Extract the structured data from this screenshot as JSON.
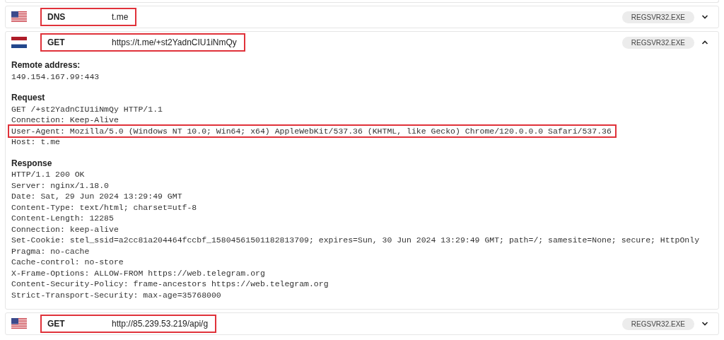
{
  "requests": [
    {
      "kind": "us",
      "method": "DNS",
      "url": "t.me",
      "highlighted": true,
      "process": "REGSVR32.EXE",
      "expanded": false
    },
    {
      "kind": "nl",
      "method": "GET",
      "url": "https://t.me/+st2YadnCIU1iNmQy",
      "highlighted": true,
      "process": "REGSVR32.EXE",
      "expanded": true,
      "details": [
        {
          "title": "Remote address:",
          "lines": [
            {
              "text": "149.154.167.99:443",
              "highlighted": false
            }
          ]
        },
        {
          "title": "Request",
          "lines": [
            {
              "text": "GET /+st2YadnCIU1iNmQy HTTP/1.1",
              "highlighted": false
            },
            {
              "text": "Connection: Keep-Alive",
              "highlighted": false
            },
            {
              "text": "User-Agent: Mozilla/5.0 (Windows NT 10.0; Win64; x64) AppleWebKit/537.36 (KHTML, like Gecko) Chrome/120.0.0.0 Safari/537.36",
              "highlighted": true
            },
            {
              "text": "Host: t.me",
              "highlighted": false
            }
          ]
        },
        {
          "title": "Response",
          "lines": [
            {
              "text": "HTTP/1.1 200 OK",
              "highlighted": false
            },
            {
              "text": "Server: nginx/1.18.0",
              "highlighted": false
            },
            {
              "text": "Date: Sat, 29 Jun 2024 13:29:49 GMT",
              "highlighted": false
            },
            {
              "text": "Content-Type: text/html; charset=utf-8",
              "highlighted": false
            },
            {
              "text": "Content-Length: 12285",
              "highlighted": false
            },
            {
              "text": "Connection: keep-alive",
              "highlighted": false
            },
            {
              "text": "Set-Cookie: stel_ssid=a2cc81a204464fccbf_15804561501182813709; expires=Sun, 30 Jun 2024 13:29:49 GMT; path=/; samesite=None; secure; HttpOnly",
              "highlighted": false
            },
            {
              "text": "Pragma: no-cache",
              "highlighted": false
            },
            {
              "text": "Cache-control: no-store",
              "highlighted": false
            },
            {
              "text": "X-Frame-Options: ALLOW-FROM https://web.telegram.org",
              "highlighted": false
            },
            {
              "text": "Content-Security-Policy: frame-ancestors https://web.telegram.org",
              "highlighted": false
            },
            {
              "text": "Strict-Transport-Security: max-age=35768000",
              "highlighted": false
            }
          ]
        }
      ]
    },
    {
      "kind": "us",
      "method": "GET",
      "url": "http://85.239.53.219/api/g",
      "highlighted": true,
      "process": "REGSVR32.EXE",
      "expanded": false
    }
  ]
}
